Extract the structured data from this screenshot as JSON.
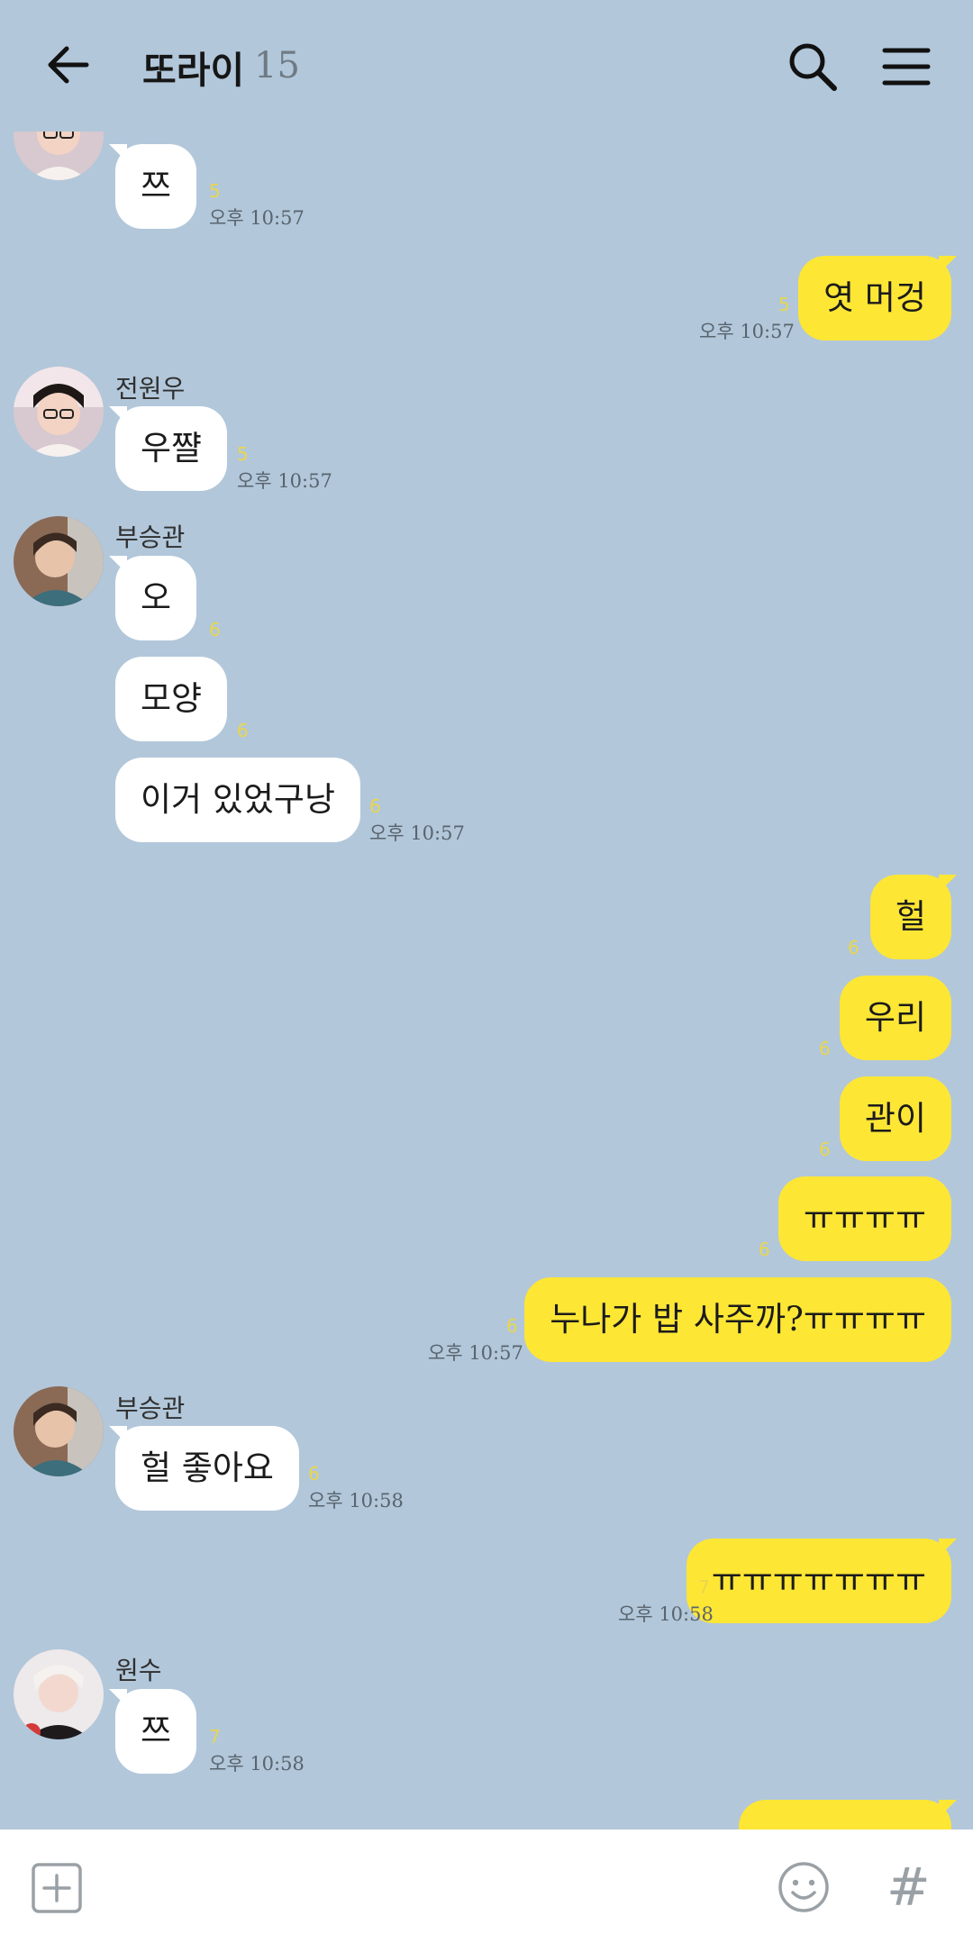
{
  "header": {
    "title": "또라이",
    "member_count": "15"
  },
  "messages": [
    {
      "sender": "",
      "text": "쯔",
      "unread": "5",
      "time": "오후 10:57"
    },
    {
      "sender": "me",
      "text": "엿 머겅",
      "unread": "5",
      "time": "오후 10:57"
    },
    {
      "sender": "전원우",
      "text": "우쨜",
      "unread": "5",
      "time": "오후 10:57"
    },
    {
      "sender": "부승관",
      "text": "오",
      "unread": "6",
      "time": ""
    },
    {
      "sender": "부승관",
      "text": "모양",
      "unread": "6",
      "time": ""
    },
    {
      "sender": "부승관",
      "text": "이거 있었구낭",
      "unread": "6",
      "time": "오후 10:57"
    },
    {
      "sender": "me",
      "text": "헐",
      "unread": "6",
      "time": ""
    },
    {
      "sender": "me",
      "text": "우리",
      "unread": "6",
      "time": ""
    },
    {
      "sender": "me",
      "text": "관이",
      "unread": "6",
      "time": ""
    },
    {
      "sender": "me",
      "text": "ㅠㅠㅠㅠ",
      "unread": "6",
      "time": ""
    },
    {
      "sender": "me",
      "text": "누나가 밥 사주까?ㅠㅠㅠㅠ",
      "unread": "6",
      "time": "오후 10:57"
    },
    {
      "sender": "부승관",
      "text": "헐 좋아요",
      "unread": "6",
      "time": "오후 10:58"
    },
    {
      "sender": "me",
      "text": "ㅠㅠㅠㅠㅠㅠㅠ",
      "unread": "7",
      "time": "오후 10:58"
    },
    {
      "sender": "원수",
      "text": "쯔",
      "unread": "7",
      "time": "오후 10:58"
    }
  ],
  "input_bar": {
    "hash_label": "#"
  },
  "colors": {
    "background": "#b2c7da",
    "bubble_mine": "#fee635",
    "bubble_other": "#ffffff",
    "unread": "#e8d64e"
  },
  "icons": [
    "back-arrow-icon",
    "search-icon",
    "menu-icon",
    "plus-icon",
    "emoji-icon"
  ]
}
